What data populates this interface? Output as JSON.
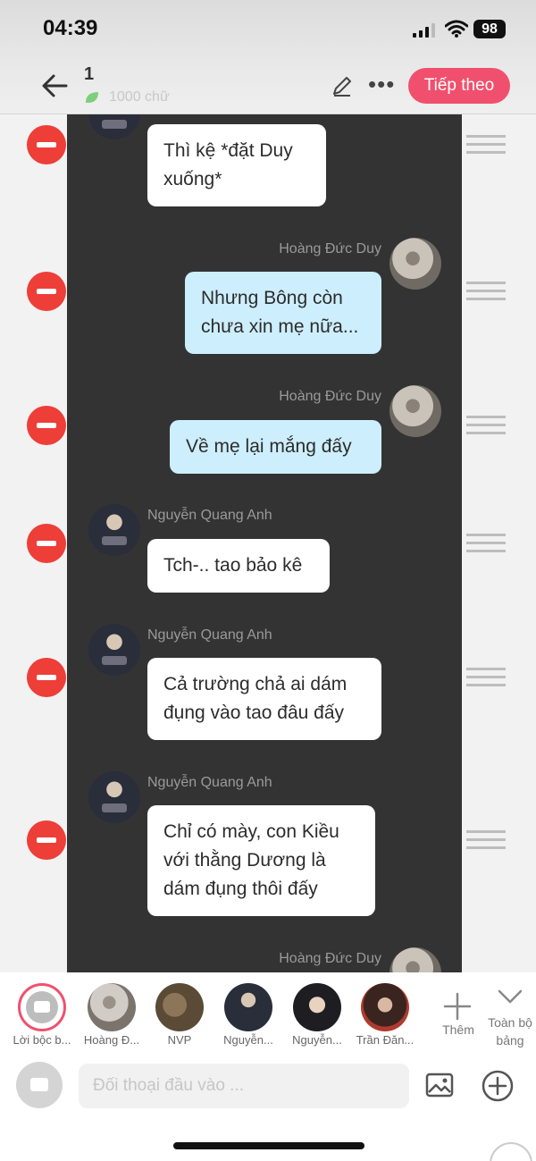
{
  "status_bar": {
    "time": "04:39",
    "battery": "98"
  },
  "header": {
    "title": "1",
    "word_count": "1000 chữ",
    "next_button": "Tiếp theo"
  },
  "messages": [
    {
      "speaker": "",
      "text": "Thì kệ *đặt Duy xuống*",
      "side": "left"
    },
    {
      "speaker": "Hoàng Đức Duy",
      "text": "Nhưng Bông còn chưa xin mẹ nữa...",
      "side": "right"
    },
    {
      "speaker": "Hoàng Đức Duy",
      "text": "Về mẹ lại mắng đấy",
      "side": "right"
    },
    {
      "speaker": "Nguyễn Quang Anh",
      "text": "Tch-.. tao bảo kê",
      "side": "left"
    },
    {
      "speaker": "Nguyễn Quang Anh",
      "text": "Cả trường chả ai dám đụng vào tao đâu đấy",
      "side": "left"
    },
    {
      "speaker": "Nguyễn Quang Anh",
      "text": "Chỉ có mày, con Kiều với thằng Dương là dám đụng thôi đấy",
      "side": "left"
    },
    {
      "speaker": "Hoàng Đức Duy",
      "text": "",
      "side": "right"
    }
  ],
  "characters": [
    {
      "label": "Lời bộc b..."
    },
    {
      "label": "Hoàng Đ..."
    },
    {
      "label": "NVP"
    },
    {
      "label": "Nguyễn..."
    },
    {
      "label": "Nguyễn..."
    },
    {
      "label": "Trần Đăn..."
    }
  ],
  "add_character_label": "Thêm",
  "collapse_label": "Toàn bộ bảng",
  "input": {
    "placeholder": "Đối thoại đầu vào ..."
  },
  "colors": {
    "accent": "#f0506e",
    "delete": "#ee3e38",
    "panel": "#333333",
    "bubble_blue": "#cdeefc"
  }
}
